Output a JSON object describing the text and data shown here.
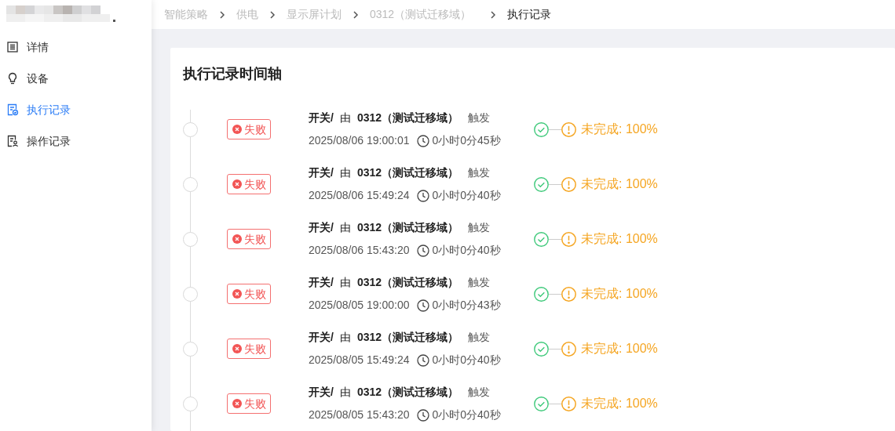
{
  "sidebar": {
    "items": [
      {
        "label": "详情",
        "selected": false
      },
      {
        "label": "设备",
        "selected": false
      },
      {
        "label": "执行记录",
        "selected": true
      },
      {
        "label": "操作记录",
        "selected": false
      }
    ]
  },
  "breadcrumb": [
    "智能策略",
    "供电",
    "显示屏计划",
    "0312（测试迁移域）",
    "执行记录"
  ],
  "card": {
    "title": "执行记录时间轴"
  },
  "records": [
    {
      "status": "失败",
      "action": "开关/",
      "by": "由",
      "source": "0312（测试迁移域）",
      "verb": "触发",
      "time": "2025/08/06 19:00:01",
      "duration": "0小时0分45秒",
      "progress": "未完成: 100%"
    },
    {
      "status": "失败",
      "action": "开关/",
      "by": "由",
      "source": "0312（测试迁移域）",
      "verb": "触发",
      "time": "2025/08/06 15:49:24",
      "duration": "0小时0分40秒",
      "progress": "未完成: 100%"
    },
    {
      "status": "失败",
      "action": "开关/",
      "by": "由",
      "source": "0312（测试迁移域）",
      "verb": "触发",
      "time": "2025/08/06 15:43:20",
      "duration": "0小时0分40秒",
      "progress": "未完成: 100%"
    },
    {
      "status": "失败",
      "action": "开关/",
      "by": "由",
      "source": "0312（测试迁移域）",
      "verb": "触发",
      "time": "2025/08/05 19:00:00",
      "duration": "0小时0分43秒",
      "progress": "未完成: 100%"
    },
    {
      "status": "失败",
      "action": "开关/",
      "by": "由",
      "source": "0312（测试迁移域）",
      "verb": "触发",
      "time": "2025/08/05 15:49:24",
      "duration": "0小时0分40秒",
      "progress": "未完成: 100%"
    },
    {
      "status": "失败",
      "action": "开关/",
      "by": "由",
      "source": "0312（测试迁移域）",
      "verb": "触发",
      "time": "2025/08/05 15:43:20",
      "duration": "0小时0分40秒",
      "progress": "未完成: 100%"
    }
  ]
}
